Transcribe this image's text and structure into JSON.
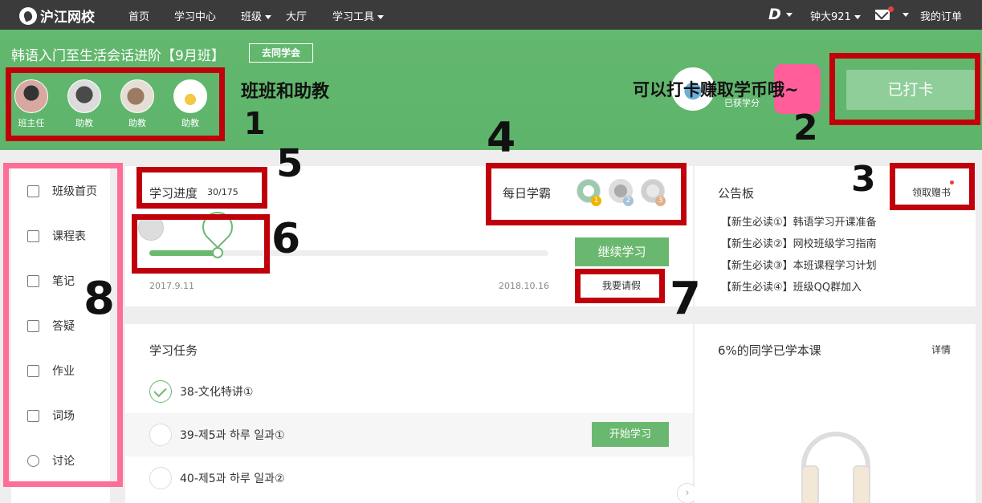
{
  "nav": {
    "logo": "沪江网校",
    "items": [
      {
        "label": "首页",
        "dropdown": false
      },
      {
        "label": "学习中心",
        "dropdown": false
      },
      {
        "label": "班级",
        "dropdown": true
      },
      {
        "label": "大厅",
        "dropdown": false
      },
      {
        "label": "学习工具",
        "dropdown": true
      }
    ],
    "brand_letter": "D",
    "username": "钟大921",
    "my_orders": "我的订单"
  },
  "hero": {
    "course_title": "韩语入门至生活会话进阶【9月班】",
    "alumni_button": "去同学会",
    "mentors": [
      {
        "role": "班主任"
      },
      {
        "role": "助教"
      },
      {
        "role": "助教"
      },
      {
        "role": "助教"
      }
    ],
    "coin_label": "已获学分",
    "checkin_button": "已打卡"
  },
  "annotations": {
    "mentors_note": "班班和助教",
    "checkin_note": "可以打卡赚取学币哦~",
    "numbers": [
      "1",
      "2",
      "3",
      "4",
      "5",
      "6",
      "7",
      "8"
    ]
  },
  "sidebar": {
    "items": [
      "班级首页",
      "课程表",
      "笔记",
      "答疑",
      "作业",
      "词场",
      "讨论"
    ]
  },
  "progress": {
    "label": "学习进度",
    "count": "30/175",
    "completed": 30,
    "total": 175,
    "start_date": "2017.9.11",
    "end_date": "2018.10.16",
    "continue_button": "继续学习",
    "leave_button": "我要请假"
  },
  "daily_top": {
    "label": "每日学霸",
    "ranks": [
      "1",
      "2",
      "3"
    ]
  },
  "notice": {
    "title": "公告板",
    "gift_link": "领取赠书",
    "items": [
      "【新生必读①】韩语学习开课准备",
      "【新生必读②】网校班级学习指南",
      "【新生必读③】本班课程学习计划",
      "【新生必读④】班级QQ群加入"
    ]
  },
  "tasks": {
    "title": "学习任务",
    "items": [
      {
        "text": "38-文化特讲①",
        "done": true
      },
      {
        "text": "39-제5과 하루 일과①",
        "done": false,
        "button": "开始学习"
      },
      {
        "text": "40-제5과 하루 일과②",
        "done": false
      }
    ]
  },
  "stat": {
    "title": "6%的同学已学本课",
    "detail": "详情"
  },
  "colors": {
    "accent_green": "#6ab86f",
    "hero_green": "#5db46a",
    "annotation_red": "#c0000a",
    "annotation_pink": "#ff6e96"
  }
}
